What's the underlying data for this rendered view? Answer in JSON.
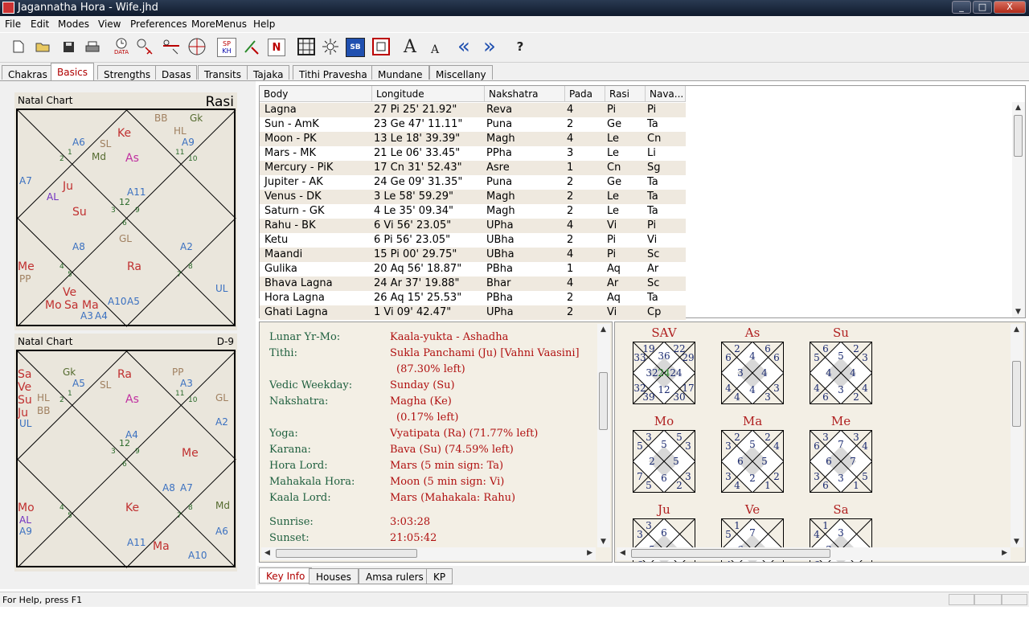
{
  "window": {
    "title": "Jagannatha Hora - Wife.jhd",
    "controls": [
      "_",
      "□",
      "X"
    ]
  },
  "menu": [
    "File",
    "Edit",
    "Modes",
    "View",
    "Preferences",
    "MoreMenus",
    "Help"
  ],
  "toolbar": {
    "data_label": "DATA",
    "sp_label": "SP",
    "kh_label": "KH",
    "n_label": "N",
    "sb_label": "SB",
    "font_big": "A",
    "font_small": "A",
    "back": "«",
    "forward": "»",
    "help": "?"
  },
  "main_tabs": [
    "Chakras",
    "Basics",
    "Strengths",
    "Dasas",
    "Transits",
    "Tajaka",
    "Tithi Pravesha",
    "Mundane",
    "Miscellany"
  ],
  "charts": {
    "rasi": {
      "label": "Natal Chart",
      "name": "Rasi"
    },
    "d9": {
      "label": "Natal Chart",
      "name": "D-9"
    }
  },
  "table": {
    "headers": [
      "Body",
      "Longitude",
      "Nakshatra",
      "Pada",
      "Rasi",
      "Nava..."
    ],
    "rows": [
      [
        "Lagna",
        "27 Pi 25' 21.92\"",
        "Reva",
        "4",
        "Pi",
        "Pi"
      ],
      [
        "Sun - AmK",
        "23 Ge 47' 11.11\"",
        "Puna",
        "2",
        "Ge",
        "Ta"
      ],
      [
        "Moon - PK",
        "13 Le 18' 39.39\"",
        "Magh",
        "4",
        "Le",
        "Cn"
      ],
      [
        "Mars - MK",
        "21 Le 06' 33.45\"",
        "PPha",
        "3",
        "Le",
        "Li"
      ],
      [
        "Mercury - PiK",
        "17 Cn 31' 52.43\"",
        "Asre",
        "1",
        "Cn",
        "Sg"
      ],
      [
        "Jupiter - AK",
        "24 Ge 09' 31.35\"",
        "Puna",
        "2",
        "Ge",
        "Ta"
      ],
      [
        "Venus - DK",
        " 3 Le 58' 59.29\"",
        "Magh",
        "2",
        "Le",
        "Ta"
      ],
      [
        "Saturn - GK",
        " 4 Le 35' 09.34\"",
        "Magh",
        "2",
        "Le",
        "Ta"
      ],
      [
        "Rahu - BK",
        " 6 Vi 56' 23.05\"",
        "UPha",
        "4",
        "Vi",
        "Pi"
      ],
      [
        "Ketu",
        " 6 Pi 56' 23.05\"",
        "UBha",
        "2",
        "Pi",
        "Vi"
      ],
      [
        "Maandi",
        "15 Pi 00' 29.75\"",
        "UBha",
        "4",
        "Pi",
        "Sc"
      ],
      [
        "Gulika",
        "20 Aq 56' 18.87\"",
        "PBha",
        "1",
        "Aq",
        "Ar"
      ],
      [
        "Bhava Lagna",
        "24 Ar 37' 19.88\"",
        "Bhar",
        "4",
        "Ar",
        "Sc"
      ],
      [
        "Hora Lagna",
        "26 Aq 15' 25.53\"",
        "PBha",
        "2",
        "Aq",
        "Ta"
      ],
      [
        "Ghati Lagna",
        " 1 Vi 09' 42.47\"",
        "UPha",
        "2",
        "Vi",
        "Cp"
      ]
    ]
  },
  "info": [
    {
      "label": "Lunar Yr-Mo:",
      "value": "Kaala-yukta - Ashadha"
    },
    {
      "label": "Tithi:",
      "value": "Sukla Panchami (Ju) [Vahni Vaasini]"
    },
    {
      "label": "",
      "value": "(87.30% left)"
    },
    {
      "label": "Vedic Weekday:",
      "value": "Sunday (Su)"
    },
    {
      "label": "Nakshatra:",
      "value": "Magha (Ke)"
    },
    {
      "label": "",
      "value": "(0.17% left)"
    },
    {
      "label": "Yoga:",
      "value": "Vyatipata (Ra) (71.77% left)"
    },
    {
      "label": "Karana:",
      "value": "Bava (Su) (74.59% left)"
    },
    {
      "label": "Hora Lord:",
      "value": "Mars (5 min sign: Ta)"
    },
    {
      "label": "Mahakala Hora:",
      "value": "Moon (5 min sign: Vi)"
    },
    {
      "label": "Kaala Lord:",
      "value": "Mars (Mahakala: Rahu)"
    },
    {
      "label": "Sunrise:",
      "value": "3:03:28"
    },
    {
      "label": "Sunset:",
      "value": "21:05:42"
    }
  ],
  "ashtakavarga": [
    {
      "title": "SAV",
      "nums": [
        "36",
        "19",
        "33",
        "32",
        "32",
        "39",
        "12",
        "30",
        "17",
        "24",
        "29",
        "22",
        "24"
      ]
    },
    {
      "title": "As",
      "nums": [
        "4",
        "2",
        "6",
        "3",
        "4",
        "4",
        "4",
        "3",
        "3",
        "4",
        "6",
        "6"
      ]
    },
    {
      "title": "Su",
      "nums": [
        "5",
        "6",
        "5",
        "4",
        "4",
        "6",
        "3",
        "2",
        "4",
        "4",
        "3",
        "2"
      ]
    },
    {
      "title": "Mo",
      "nums": [
        "5",
        "3",
        "5",
        "2",
        "7",
        "5",
        "6",
        "2",
        "3",
        "5",
        "3",
        "5"
      ]
    },
    {
      "title": "Ma",
      "nums": [
        "5",
        "2",
        "3",
        "6",
        "3",
        "4",
        "2",
        "1",
        "2",
        "5",
        "4",
        "2"
      ]
    },
    {
      "title": "Me",
      "nums": [
        "7",
        "3",
        "6",
        "6",
        "3",
        "6",
        "3",
        "1",
        "5",
        "7",
        "4",
        "3"
      ]
    },
    {
      "title": "Ju",
      "nums": [
        "6",
        "3",
        "3",
        "5",
        "6",
        "7"
      ]
    },
    {
      "title": "Ve",
      "nums": [
        "7",
        "1",
        "5",
        "6",
        "4",
        "4"
      ]
    },
    {
      "title": "Sa",
      "nums": [
        "3",
        "1",
        "4",
        "3",
        "6",
        "7",
        "5"
      ]
    }
  ],
  "bottom_tabs": [
    "Key Info",
    "Houses",
    "Amsa rulers",
    "KP"
  ],
  "status": {
    "text": "For Help, press F1"
  }
}
